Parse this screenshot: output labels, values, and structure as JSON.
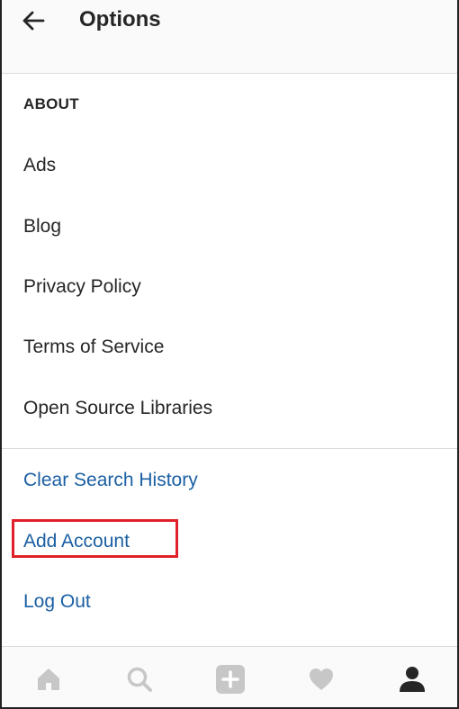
{
  "header": {
    "title": "Options",
    "back_icon": "arrow-left-icon"
  },
  "about": {
    "section_label": "ABOUT",
    "items": [
      {
        "label": "Ads"
      },
      {
        "label": "Blog"
      },
      {
        "label": "Privacy Policy"
      },
      {
        "label": "Terms of Service"
      },
      {
        "label": "Open Source Libraries"
      }
    ]
  },
  "actions": {
    "clear_search": "Clear Search History",
    "add_account": "Add Account",
    "log_out": "Log Out"
  },
  "colors": {
    "action_text": "#1b5fa3",
    "highlight": "#e0202a",
    "inactive_tab": "#c7c7c7",
    "active_tab": "#262626"
  },
  "tabbar": {
    "tabs": [
      {
        "icon": "home-icon",
        "active": false
      },
      {
        "icon": "search-icon",
        "active": false
      },
      {
        "icon": "add-post-icon",
        "active": false
      },
      {
        "icon": "heart-icon",
        "active": false
      },
      {
        "icon": "profile-icon",
        "active": true
      }
    ]
  }
}
